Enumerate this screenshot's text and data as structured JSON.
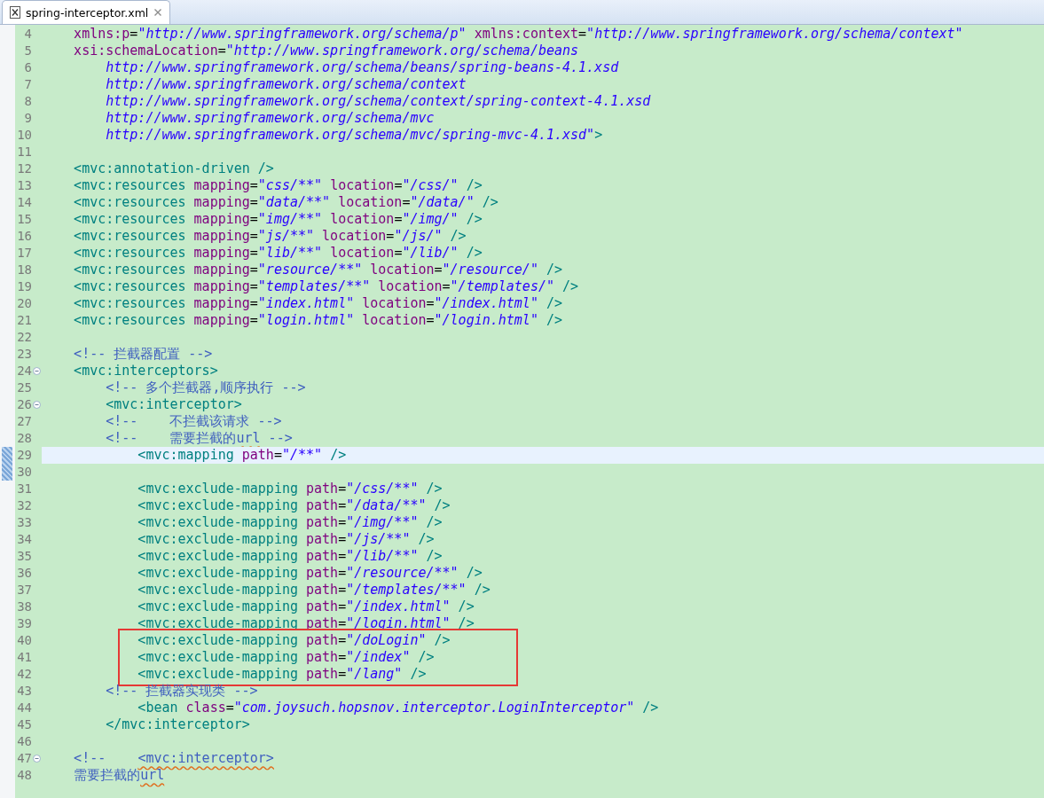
{
  "tab": {
    "title": "spring-interceptor.xml",
    "selected": true
  },
  "lines": [
    {
      "number": "4",
      "current": false,
      "foldable": false,
      "boxed": false,
      "tokens": [
        {
          "kind": "attr",
          "text": "    xmlns:p"
        },
        {
          "kind": "plain",
          "text": "="
        },
        {
          "kind": "value",
          "text": "\"http://www.springframework.org/schema/p\" "
        },
        {
          "kind": "attr",
          "text": "xmlns:context"
        },
        {
          "kind": "plain",
          "text": "="
        },
        {
          "kind": "value",
          "text": "\"http://www.springframework.org/schema/context\""
        }
      ]
    },
    {
      "number": "5",
      "current": false,
      "foldable": false,
      "boxed": false,
      "tokens": [
        {
          "kind": "attr",
          "text": "    xsi:schemaLocation"
        },
        {
          "kind": "plain",
          "text": "="
        },
        {
          "kind": "value",
          "text": "\"http://www.springframework.org/schema/beans"
        }
      ]
    },
    {
      "number": "6",
      "current": false,
      "foldable": false,
      "boxed": false,
      "tokens": [
        {
          "kind": "value",
          "text": "        http://www.springframework.org/schema/beans/spring-beans-4.1.xsd"
        }
      ]
    },
    {
      "number": "7",
      "current": false,
      "foldable": false,
      "boxed": false,
      "tokens": [
        {
          "kind": "value",
          "text": "        http://www.springframework.org/schema/context"
        }
      ]
    },
    {
      "number": "8",
      "current": false,
      "foldable": false,
      "boxed": false,
      "tokens": [
        {
          "kind": "value",
          "text": "        http://www.springframework.org/schema/context/spring-context-4.1.xsd"
        }
      ]
    },
    {
      "number": "9",
      "current": false,
      "foldable": false,
      "boxed": false,
      "tokens": [
        {
          "kind": "value",
          "text": "        http://www.springframework.org/schema/mvc"
        }
      ]
    },
    {
      "number": "10",
      "current": false,
      "foldable": false,
      "boxed": false,
      "tokens": [
        {
          "kind": "value",
          "text": "        http://www.springframework.org/schema/mvc/spring-mvc-4.1.xsd\""
        },
        {
          "kind": "tag",
          "text": ">"
        }
      ]
    },
    {
      "number": "11",
      "current": false,
      "foldable": false,
      "boxed": false
    },
    {
      "number": "12",
      "current": false,
      "foldable": false,
      "boxed": false,
      "tokens": [
        {
          "kind": "tag",
          "text": "    <mvc:annotation-driven />"
        }
      ]
    },
    {
      "number": "13",
      "current": false,
      "foldable": false,
      "boxed": false,
      "tokens": [
        {
          "kind": "tag",
          "text": "    <mvc:resources "
        },
        {
          "kind": "attr",
          "text": "mapping"
        },
        {
          "kind": "plain",
          "text": "="
        },
        {
          "kind": "value",
          "text": "\"css/**\" "
        },
        {
          "kind": "attr",
          "text": "location"
        },
        {
          "kind": "plain",
          "text": "="
        },
        {
          "kind": "value",
          "text": "\"/css/\" "
        },
        {
          "kind": "tag",
          "text": "/>"
        }
      ]
    },
    {
      "number": "14",
      "current": false,
      "foldable": false,
      "boxed": false,
      "tokens": [
        {
          "kind": "tag",
          "text": "    <mvc:resources "
        },
        {
          "kind": "attr",
          "text": "mapping"
        },
        {
          "kind": "plain",
          "text": "="
        },
        {
          "kind": "value",
          "text": "\"data/**\" "
        },
        {
          "kind": "attr",
          "text": "location"
        },
        {
          "kind": "plain",
          "text": "="
        },
        {
          "kind": "value",
          "text": "\"/data/\" "
        },
        {
          "kind": "tag",
          "text": "/>"
        }
      ]
    },
    {
      "number": "15",
      "current": false,
      "foldable": false,
      "boxed": false,
      "tokens": [
        {
          "kind": "tag",
          "text": "    <mvc:resources "
        },
        {
          "kind": "attr",
          "text": "mapping"
        },
        {
          "kind": "plain",
          "text": "="
        },
        {
          "kind": "value",
          "text": "\"img/**\" "
        },
        {
          "kind": "attr",
          "text": "location"
        },
        {
          "kind": "plain",
          "text": "="
        },
        {
          "kind": "value",
          "text": "\"/img/\" "
        },
        {
          "kind": "tag",
          "text": "/>"
        }
      ]
    },
    {
      "number": "16",
      "current": false,
      "foldable": false,
      "boxed": false,
      "tokens": [
        {
          "kind": "tag",
          "text": "    <mvc:resources "
        },
        {
          "kind": "attr",
          "text": "mapping"
        },
        {
          "kind": "plain",
          "text": "="
        },
        {
          "kind": "value",
          "text": "\"js/**\" "
        },
        {
          "kind": "attr",
          "text": "location"
        },
        {
          "kind": "plain",
          "text": "="
        },
        {
          "kind": "value",
          "text": "\"/js/\" "
        },
        {
          "kind": "tag",
          "text": "/>"
        }
      ]
    },
    {
      "number": "17",
      "current": false,
      "foldable": false,
      "boxed": false,
      "tokens": [
        {
          "kind": "tag",
          "text": "    <mvc:resources "
        },
        {
          "kind": "attr",
          "text": "mapping"
        },
        {
          "kind": "plain",
          "text": "="
        },
        {
          "kind": "value",
          "text": "\"lib/**\" "
        },
        {
          "kind": "attr",
          "text": "location"
        },
        {
          "kind": "plain",
          "text": "="
        },
        {
          "kind": "value",
          "text": "\"/lib/\" "
        },
        {
          "kind": "tag",
          "text": "/>"
        }
      ]
    },
    {
      "number": "18",
      "current": false,
      "foldable": false,
      "boxed": false,
      "tokens": [
        {
          "kind": "tag",
          "text": "    <mvc:resources "
        },
        {
          "kind": "attr",
          "text": "mapping"
        },
        {
          "kind": "plain",
          "text": "="
        },
        {
          "kind": "value",
          "text": "\"resource/**\" "
        },
        {
          "kind": "attr",
          "text": "location"
        },
        {
          "kind": "plain",
          "text": "="
        },
        {
          "kind": "value",
          "text": "\"/resource/\" "
        },
        {
          "kind": "tag",
          "text": "/>"
        }
      ]
    },
    {
      "number": "19",
      "current": false,
      "foldable": false,
      "boxed": false,
      "tokens": [
        {
          "kind": "tag",
          "text": "    <mvc:resources "
        },
        {
          "kind": "attr",
          "text": "mapping"
        },
        {
          "kind": "plain",
          "text": "="
        },
        {
          "kind": "value",
          "text": "\"templates/**\" "
        },
        {
          "kind": "attr",
          "text": "location"
        },
        {
          "kind": "plain",
          "text": "="
        },
        {
          "kind": "value",
          "text": "\"/templates/\" "
        },
        {
          "kind": "tag",
          "text": "/>"
        }
      ]
    },
    {
      "number": "20",
      "current": false,
      "foldable": false,
      "boxed": false,
      "tokens": [
        {
          "kind": "tag",
          "text": "    <mvc:resources "
        },
        {
          "kind": "attr",
          "text": "mapping"
        },
        {
          "kind": "plain",
          "text": "="
        },
        {
          "kind": "value",
          "text": "\"index.html\" "
        },
        {
          "kind": "attr",
          "text": "location"
        },
        {
          "kind": "plain",
          "text": "="
        },
        {
          "kind": "value",
          "text": "\"/index.html\" "
        },
        {
          "kind": "tag",
          "text": "/>"
        }
      ]
    },
    {
      "number": "21",
      "current": false,
      "foldable": false,
      "boxed": false,
      "tokens": [
        {
          "kind": "tag",
          "text": "    <mvc:resources "
        },
        {
          "kind": "attr",
          "text": "mapping"
        },
        {
          "kind": "plain",
          "text": "="
        },
        {
          "kind": "value",
          "text": "\"login.html\" "
        },
        {
          "kind": "attr",
          "text": "location"
        },
        {
          "kind": "plain",
          "text": "="
        },
        {
          "kind": "value",
          "text": "\"/login.html\" "
        },
        {
          "kind": "tag",
          "text": "/>"
        }
      ]
    },
    {
      "number": "22",
      "current": false,
      "foldable": false,
      "boxed": false
    },
    {
      "number": "23",
      "current": false,
      "foldable": false,
      "boxed": false,
      "tokens": [
        {
          "kind": "comment",
          "text": "    <!-- 拦截器配置 -->"
        }
      ]
    },
    {
      "number": "24",
      "current": false,
      "foldable": true,
      "boxed": false,
      "tokens": [
        {
          "kind": "tag",
          "text": "    <mvc:interceptors>"
        }
      ]
    },
    {
      "number": "25",
      "current": false,
      "foldable": false,
      "boxed": false,
      "tokens": [
        {
          "kind": "comment",
          "text": "        <!-- 多个拦截器,顺序执行 -->"
        }
      ]
    },
    {
      "number": "26",
      "current": false,
      "foldable": true,
      "boxed": false,
      "tokens": [
        {
          "kind": "tag",
          "text": "        <mvc:interceptor>"
        }
      ]
    },
    {
      "number": "27",
      "current": false,
      "foldable": false,
      "boxed": false,
      "tokens": [
        {
          "kind": "comment",
          "text": "        <!--    不拦截该请求 -->"
        }
      ]
    },
    {
      "number": "28",
      "current": false,
      "foldable": false,
      "boxed": false,
      "tokens": [
        {
          "kind": "comment",
          "text": "        <!--    需要拦截的"
        },
        {
          "kind": "comment_misspelled",
          "text": "url"
        },
        {
          "kind": "comment",
          "text": " -->"
        }
      ]
    },
    {
      "number": "29",
      "current": true,
      "foldable": false,
      "boxed": false,
      "tokens": [
        {
          "kind": "tag",
          "text": "            <mvc:mapping "
        },
        {
          "kind": "attr",
          "text": "path"
        },
        {
          "kind": "plain",
          "text": "="
        },
        {
          "kind": "value",
          "text": "\"/**\" "
        },
        {
          "kind": "tag",
          "text": "/>"
        }
      ]
    },
    {
      "number": "30",
      "current": false,
      "foldable": false,
      "boxed": false
    },
    {
      "number": "31",
      "current": false,
      "foldable": false,
      "boxed": false,
      "tokens": [
        {
          "kind": "tag",
          "text": "            <mvc:exclude-mapping "
        },
        {
          "kind": "attr",
          "text": "path"
        },
        {
          "kind": "plain",
          "text": "="
        },
        {
          "kind": "value",
          "text": "\"/css/**\" "
        },
        {
          "kind": "tag",
          "text": "/>"
        }
      ]
    },
    {
      "number": "32",
      "current": false,
      "foldable": false,
      "boxed": false,
      "tokens": [
        {
          "kind": "tag",
          "text": "            <mvc:exclude-mapping "
        },
        {
          "kind": "attr",
          "text": "path"
        },
        {
          "kind": "plain",
          "text": "="
        },
        {
          "kind": "value",
          "text": "\"/data/**\" "
        },
        {
          "kind": "tag",
          "text": "/>"
        }
      ]
    },
    {
      "number": "33",
      "current": false,
      "foldable": false,
      "boxed": false,
      "tokens": [
        {
          "kind": "tag",
          "text": "            <mvc:exclude-mapping "
        },
        {
          "kind": "attr",
          "text": "path"
        },
        {
          "kind": "plain",
          "text": "="
        },
        {
          "kind": "value",
          "text": "\"/img/**\" "
        },
        {
          "kind": "tag",
          "text": "/>"
        }
      ]
    },
    {
      "number": "34",
      "current": false,
      "foldable": false,
      "boxed": false,
      "tokens": [
        {
          "kind": "tag",
          "text": "            <mvc:exclude-mapping "
        },
        {
          "kind": "attr",
          "text": "path"
        },
        {
          "kind": "plain",
          "text": "="
        },
        {
          "kind": "value",
          "text": "\"/js/**\" "
        },
        {
          "kind": "tag",
          "text": "/>"
        }
      ]
    },
    {
      "number": "35",
      "current": false,
      "foldable": false,
      "boxed": false,
      "tokens": [
        {
          "kind": "tag",
          "text": "            <mvc:exclude-mapping "
        },
        {
          "kind": "attr",
          "text": "path"
        },
        {
          "kind": "plain",
          "text": "="
        },
        {
          "kind": "value",
          "text": "\"/lib/**\" "
        },
        {
          "kind": "tag",
          "text": "/>"
        }
      ]
    },
    {
      "number": "36",
      "current": false,
      "foldable": false,
      "boxed": false,
      "tokens": [
        {
          "kind": "tag",
          "text": "            <mvc:exclude-mapping "
        },
        {
          "kind": "attr",
          "text": "path"
        },
        {
          "kind": "plain",
          "text": "="
        },
        {
          "kind": "value",
          "text": "\"/resource/**\" "
        },
        {
          "kind": "tag",
          "text": "/>"
        }
      ]
    },
    {
      "number": "37",
      "current": false,
      "foldable": false,
      "boxed": false,
      "tokens": [
        {
          "kind": "tag",
          "text": "            <mvc:exclude-mapping "
        },
        {
          "kind": "attr",
          "text": "path"
        },
        {
          "kind": "plain",
          "text": "="
        },
        {
          "kind": "value",
          "text": "\"/templates/**\" "
        },
        {
          "kind": "tag",
          "text": "/>"
        }
      ]
    },
    {
      "number": "38",
      "current": false,
      "foldable": false,
      "boxed": false,
      "tokens": [
        {
          "kind": "tag",
          "text": "            <mvc:exclude-mapping "
        },
        {
          "kind": "attr",
          "text": "path"
        },
        {
          "kind": "plain",
          "text": "="
        },
        {
          "kind": "value",
          "text": "\"/index.html\" "
        },
        {
          "kind": "tag",
          "text": "/>"
        }
      ]
    },
    {
      "number": "39",
      "current": false,
      "foldable": false,
      "boxed": false,
      "tokens": [
        {
          "kind": "tag",
          "text": "            <mvc:exclude-mapping "
        },
        {
          "kind": "attr",
          "text": "path"
        },
        {
          "kind": "plain",
          "text": "="
        },
        {
          "kind": "value",
          "text": "\"/login.html\" "
        },
        {
          "kind": "tag",
          "text": "/>"
        }
      ]
    },
    {
      "number": "40",
      "current": false,
      "foldable": false,
      "boxed": true,
      "tokens": [
        {
          "kind": "tag",
          "text": "            <mvc:exclude-mapping "
        },
        {
          "kind": "attr",
          "text": "path"
        },
        {
          "kind": "plain",
          "text": "="
        },
        {
          "kind": "value",
          "text": "\"/doLogin\" "
        },
        {
          "kind": "tag",
          "text": "/>"
        }
      ]
    },
    {
      "number": "41",
      "current": false,
      "foldable": false,
      "boxed": true,
      "tokens": [
        {
          "kind": "tag",
          "text": "            <mvc:exclude-mapping "
        },
        {
          "kind": "attr",
          "text": "path"
        },
        {
          "kind": "plain",
          "text": "="
        },
        {
          "kind": "value",
          "text": "\"/index\" "
        },
        {
          "kind": "tag",
          "text": "/>"
        }
      ]
    },
    {
      "number": "42",
      "current": false,
      "foldable": false,
      "boxed": true,
      "tokens": [
        {
          "kind": "tag",
          "text": "            <mvc:exclude-mapping "
        },
        {
          "kind": "attr",
          "text": "path"
        },
        {
          "kind": "plain",
          "text": "="
        },
        {
          "kind": "value",
          "text": "\"/lang\" "
        },
        {
          "kind": "tag",
          "text": "/>"
        }
      ]
    },
    {
      "number": "43",
      "current": false,
      "foldable": false,
      "boxed": false,
      "tokens": [
        {
          "kind": "comment",
          "text": "        <!-- 拦截器实现类 -->"
        }
      ]
    },
    {
      "number": "44",
      "current": false,
      "foldable": false,
      "boxed": false,
      "tokens": [
        {
          "kind": "tag",
          "text": "            <bean "
        },
        {
          "kind": "attr",
          "text": "class"
        },
        {
          "kind": "plain",
          "text": "="
        },
        {
          "kind": "value",
          "text": "\"com.joysuch.hopsnov.interceptor.LoginInterceptor\" "
        },
        {
          "kind": "tag",
          "text": "/>"
        }
      ]
    },
    {
      "number": "45",
      "current": false,
      "foldable": false,
      "boxed": false,
      "tokens": [
        {
          "kind": "tag",
          "text": "        </mvc:interceptor>"
        }
      ]
    },
    {
      "number": "46",
      "current": false,
      "foldable": false,
      "boxed": false
    },
    {
      "number": "47",
      "current": false,
      "foldable": true,
      "boxed": false,
      "tokens": [
        {
          "kind": "comment",
          "text": "    <!--    "
        },
        {
          "kind": "comment_misspelled",
          "text": "<mvc:interceptor>"
        }
      ]
    },
    {
      "number": "48",
      "current": false,
      "foldable": false,
      "boxed": false,
      "tokens": [
        {
          "kind": "comment",
          "text": "    需要拦截的"
        },
        {
          "kind": "comment_misspelled",
          "text": "url"
        }
      ]
    }
  ]
}
